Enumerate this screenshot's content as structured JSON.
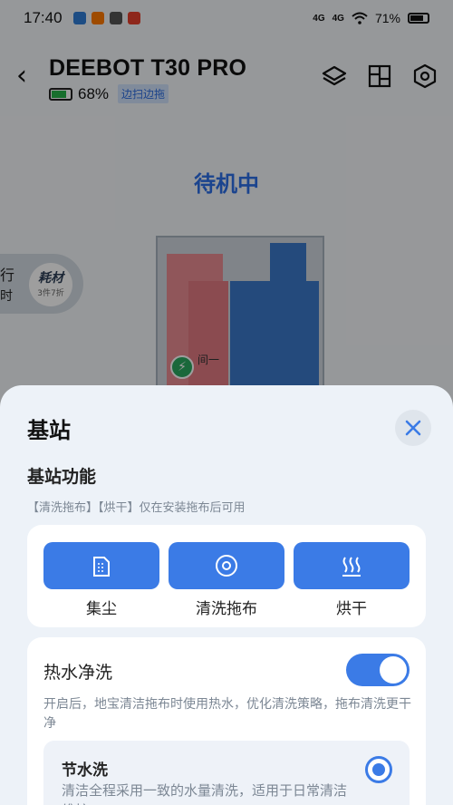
{
  "status_bar": {
    "time": "17:40",
    "signal1": "4G",
    "signal2": "4G",
    "battery": "71%"
  },
  "header": {
    "device_name": "DEEBOT T30 PRO",
    "battery_percent": "68%",
    "mode_badge": "边扫边拖"
  },
  "robot_state": "待机中",
  "map": {
    "room_label": "间一"
  },
  "side_panel": {
    "partial_text1": "行",
    "partial_text2": "时",
    "consumables_label": "耗材",
    "consumables_sub": "3件7折"
  },
  "sheet": {
    "title": "基站",
    "section_title": "基站功能",
    "section_note": "【清洗拖布】【烘干】仅在安装拖布后可用",
    "functions": [
      {
        "label": "集尘",
        "icon": "dust-bin-icon"
      },
      {
        "label": "清洗拖布",
        "icon": "mop-wash-icon"
      },
      {
        "label": "烘干",
        "icon": "heat-dry-icon"
      }
    ],
    "hot_water": {
      "title": "热水净洗",
      "enabled": true,
      "description": "开启后，地宝清洁拖布时使用热水，优化清洗策略，拖布清洗更干净"
    },
    "options": [
      {
        "title": "节水洗",
        "description": "清洁全程采用一致的水量清洗，适用于日常清洁维护",
        "selected": true
      }
    ]
  },
  "colors": {
    "accent": "#3b7be6",
    "state_blue": "#2d6ee6",
    "muted_text": "#7c8794"
  }
}
